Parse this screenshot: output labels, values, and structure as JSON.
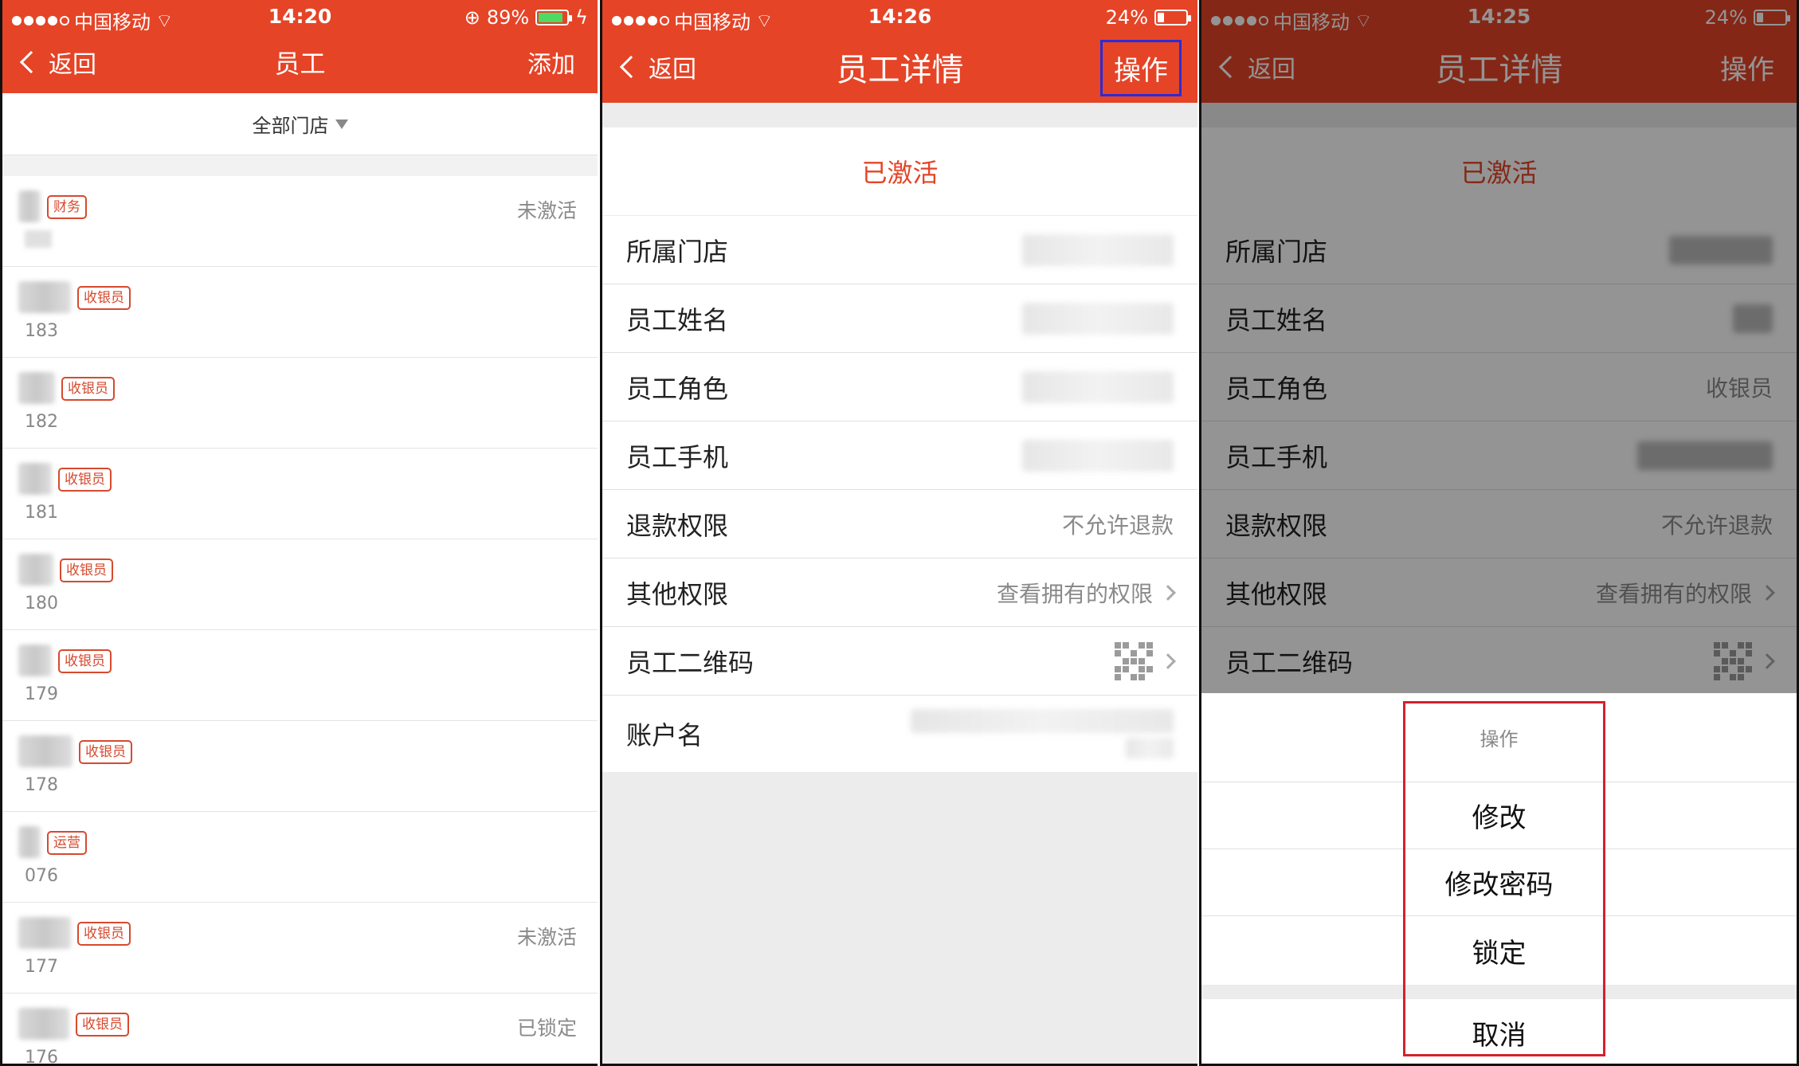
{
  "colors": {
    "brand": "#e54427",
    "tag": "#d64a2e",
    "highlight_blue": "#2b2bd6",
    "highlight_red": "#d6202f"
  },
  "panel1": {
    "status": {
      "carrier": "中国移动",
      "time": "14:20",
      "battery": "89%",
      "battery_level": 0.89
    },
    "nav": {
      "back": "返回",
      "title": "员工",
      "action": "添加"
    },
    "filter": "全部门店",
    "employees": [
      {
        "tag": "财务",
        "num": "",
        "status": "未激活"
      },
      {
        "tag": "收银员",
        "num": "183",
        "status": ""
      },
      {
        "tag": "收银员",
        "num": "182",
        "status": ""
      },
      {
        "tag": "收银员",
        "num": "181",
        "status": ""
      },
      {
        "tag": "收银员",
        "num": "180",
        "status": ""
      },
      {
        "tag": "收银员",
        "num": "179",
        "status": ""
      },
      {
        "tag": "收银员",
        "num": "178",
        "status": ""
      },
      {
        "tag": "运营",
        "num": "076",
        "status": ""
      },
      {
        "tag": "收银员",
        "num": "177",
        "status": "未激活"
      },
      {
        "tag": "收银员",
        "num": "176",
        "status": "已锁定"
      }
    ]
  },
  "panel2": {
    "status": {
      "carrier": "中国移动",
      "time": "14:26",
      "battery": "24%",
      "battery_level": 0.24
    },
    "nav": {
      "back": "返回",
      "title": "员工详情",
      "action": "操作"
    },
    "state": "已激活",
    "fields": {
      "store": "所属门店",
      "name": "员工姓名",
      "role": "员工角色",
      "phone": "员工手机",
      "refund": "退款权限",
      "refund_value": "不允许退款",
      "other": "其他权限",
      "other_value": "查看拥有的权限",
      "qrcode": "员工二维码",
      "account": "账户名"
    }
  },
  "panel3": {
    "status": {
      "carrier": "中国移动",
      "time": "14:25",
      "battery": "24%",
      "battery_level": 0.24
    },
    "nav": {
      "back": "返回",
      "title": "员工详情",
      "action": "操作"
    },
    "state": "已激活",
    "fields": {
      "store": "所属门店",
      "name": "员工姓名",
      "role": "员工角色",
      "role_value": "收银员",
      "phone": "员工手机",
      "refund": "退款权限",
      "refund_value": "不允许退款",
      "other": "其他权限",
      "other_value": "查看拥有的权限",
      "qrcode": "员工二维码"
    },
    "sheet": {
      "title": "操作",
      "edit": "修改",
      "change_password": "修改密码",
      "lock": "锁定",
      "cancel": "取消"
    }
  }
}
